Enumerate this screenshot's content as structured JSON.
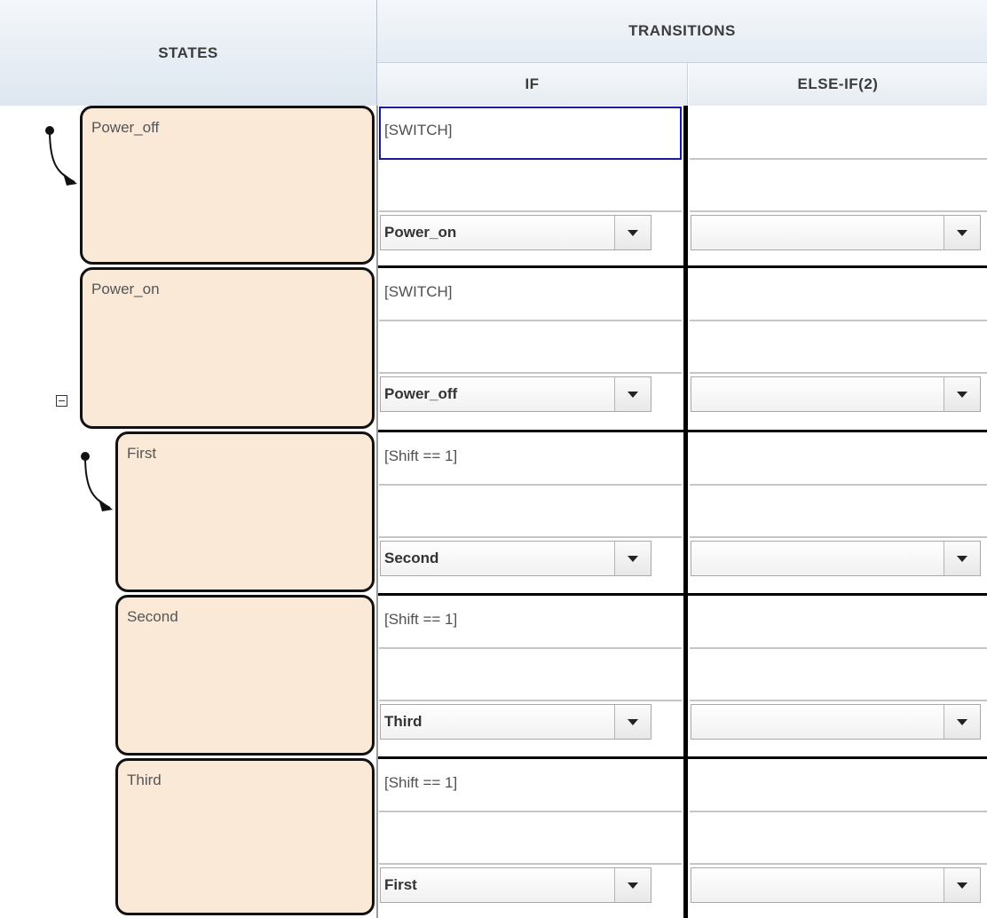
{
  "headers": {
    "states": "STATES",
    "transitions": "TRANSITIONS",
    "if": "IF",
    "else_if": "ELSE-IF(2)"
  },
  "states": [
    {
      "name": "Power_off",
      "default": true,
      "if": {
        "condition": "[SWITCH]",
        "action": "",
        "destination": "Power_on"
      },
      "else_if": {
        "condition": "",
        "action": "",
        "destination": ""
      }
    },
    {
      "name": "Power_on",
      "default": false,
      "collapsible": true,
      "if": {
        "condition": "[SWITCH]",
        "action": "",
        "destination": "Power_off"
      },
      "else_if": {
        "condition": "",
        "action": "",
        "destination": ""
      }
    },
    {
      "name": "First",
      "default": true,
      "if": {
        "condition": "[Shift == 1]",
        "action": "",
        "destination": "Second"
      },
      "else_if": {
        "condition": "",
        "action": "",
        "destination": ""
      }
    },
    {
      "name": "Second",
      "default": false,
      "if": {
        "condition": "[Shift == 1]",
        "action": "",
        "destination": "Third"
      },
      "else_if": {
        "condition": "",
        "action": "",
        "destination": ""
      }
    },
    {
      "name": "Third",
      "default": false,
      "if": {
        "condition": "[Shift == 1]",
        "action": "",
        "destination": "First"
      },
      "else_if": {
        "condition": "",
        "action": "",
        "destination": ""
      }
    }
  ],
  "colors": {
    "state_fill": "#fae9d7",
    "focus_outline": "#1a1aa0"
  }
}
